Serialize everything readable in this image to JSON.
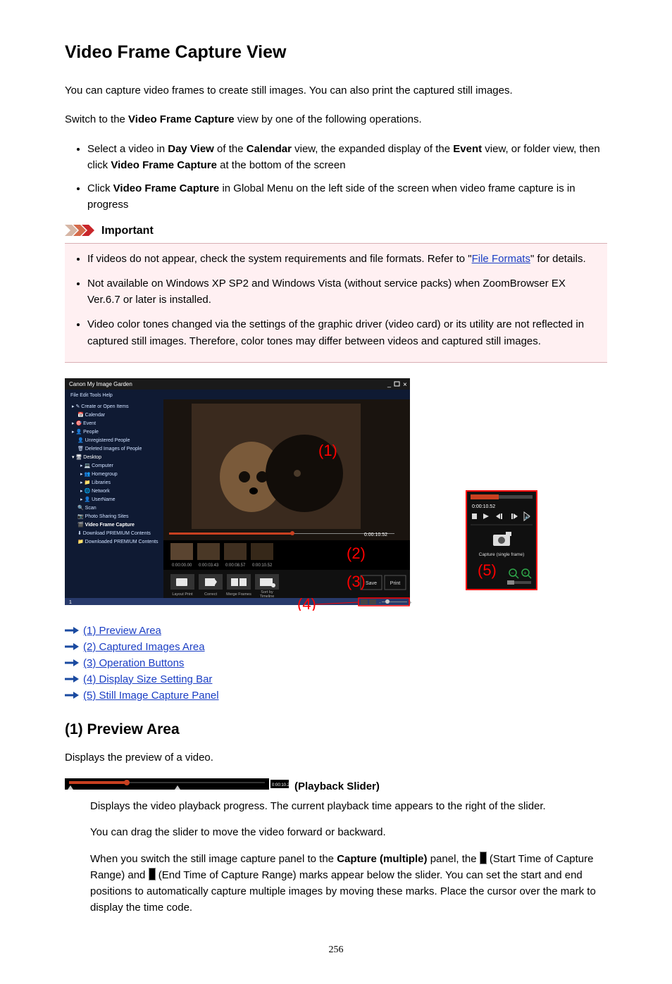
{
  "title": "Video Frame Capture View",
  "intro1": "You can capture video frames to create still images. You can also print the captured still images.",
  "intro2_pre": "Switch to the ",
  "intro2_bold": "Video Frame Capture",
  "intro2_post": " view by one of the following operations.",
  "bullets1": {
    "b1_p1": "Select a video in ",
    "b1_b1": "Day View",
    "b1_p2": " of the ",
    "b1_b2": "Calendar",
    "b1_p3": " view, the expanded display of the ",
    "b1_b3": "Event",
    "b1_p4": " view, or folder view, then click ",
    "b1_b4": "Video Frame Capture",
    "b1_p5": " at the bottom of the screen",
    "b2_p1": "Click ",
    "b2_b1": "Video Frame Capture",
    "b2_p2": " in Global Menu on the left side of the screen when video frame capture is in progress"
  },
  "important_label": "Important",
  "important": {
    "i1_p1": "If videos do not appear, check the system requirements and file formats. Refer to \"",
    "i1_link": "File Formats",
    "i1_p2": "\" for details.",
    "i2": "Not available on Windows XP SP2 and Windows Vista (without service packs) when ZoomBrowser EX Ver.6.7 or later is installed.",
    "i3": "Video color tones changed via the settings of the graphic driver (video card) or its utility are not reflected in captured still images. Therefore, color tones may differ between videos and captured still images."
  },
  "anchors": [
    "(1) Preview Area",
    "(2) Captured Images Area",
    "(3) Operation Buttons",
    "(4) Display Size Setting Bar",
    "(5) Still Image Capture Panel"
  ],
  "section1_title": "(1) Preview Area",
  "section1_desc": "Displays the preview of a video.",
  "slider_label": " (Playback Slider)",
  "slider_p1": "Displays the video playback progress. The current playback time appears to the right of the slider.",
  "slider_p2": "You can drag the slider to move the video forward or backward.",
  "slider_p3_p1": "When you switch the still image capture panel to the ",
  "slider_p3_b1": "Capture (multiple)",
  "slider_p3_p2": " panel, the ",
  "slider_p3_p3": " (Start Time of Capture Range) and ",
  "slider_p3_p4": " (End Time of Capture Range) marks appear below the slider. You can set the start and end positions to automatically capture multiple images by moving these marks. Place the cursor over the mark to display the time code.",
  "page_number": "256",
  "app_window": {
    "title": "Canon My Image Garden",
    "menu": [
      "File",
      "Edit",
      "Tools",
      "Help"
    ],
    "sidebar": [
      "Create or Open Items",
      "Calendar",
      "Event",
      "People",
      "Unregistered People",
      "Deleted Images of People",
      "Desktop",
      "Computer",
      "Homegroup",
      "Libraries",
      "Network",
      "UserName",
      "Scan",
      "Photo Sharing Sites",
      "Video Frame Capture",
      "Download PREMIUM Contents",
      "Downloaded PREMIUM Contents"
    ],
    "preview_time": "0:00:10.52",
    "thumb_times": [
      "0:00:00.00",
      "0:00:03.43",
      "0:00:08.57",
      "0:00:10.52"
    ],
    "op_buttons": [
      "Layout Print",
      "Correct",
      "Merge Frames",
      "Sort by Timeline"
    ],
    "action_buttons": [
      "Save",
      "Print"
    ],
    "capture_panel": {
      "time": "0:00:10.52",
      "capture_label": "Capture (single frame)"
    },
    "callouts": [
      "(1)",
      "(2)",
      "(3)",
      "(4)",
      "(5)"
    ]
  }
}
